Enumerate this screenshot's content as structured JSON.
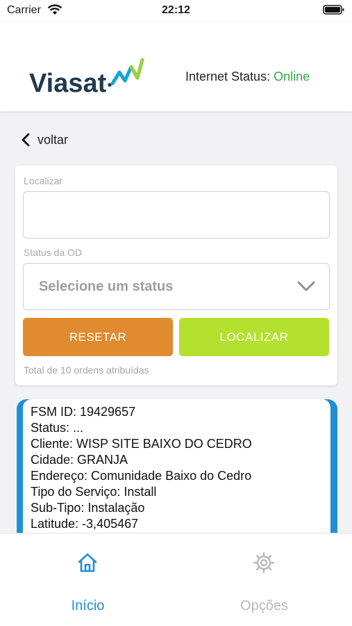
{
  "status_bar": {
    "carrier": "Carrier",
    "time": "22:12"
  },
  "header": {
    "logo_text": "Viasat",
    "internet_status_label": "Internet Status:",
    "internet_status_value": "Online"
  },
  "nav": {
    "back_label": "voltar"
  },
  "filter": {
    "search_label": "Localizar",
    "search_value": "",
    "status_label": "Status da OD",
    "status_placeholder": "Selecione um status",
    "reset_label": "RESETAR",
    "search_button_label": "LOCALIZAR",
    "total_text": "Total de 10 ordens atribuídas"
  },
  "order": {
    "lines": [
      "FSM ID: 19429657",
      "Status: ...",
      "Cliente: WISP SITE BAIXO DO CEDRO",
      "Cidade: GRANJA",
      "Endereço: Comunidade Baixo do Cedro",
      "Tipo do Serviço: Install",
      "Sub-Tipo: Instalação",
      "Latitude: -3,405467"
    ]
  },
  "tabbar": {
    "home_label": "Início",
    "options_label": "Opções"
  },
  "colors": {
    "brand_dark": "#1f3a4e",
    "accent_blue": "#1f8fd6",
    "online_green": "#2ea84a",
    "reset_orange": "#e08b30",
    "search_lime": "#b4e02f"
  }
}
